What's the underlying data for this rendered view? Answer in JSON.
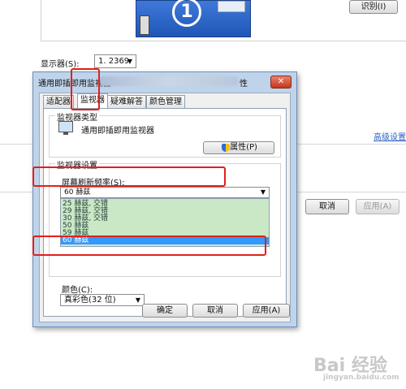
{
  "background": {
    "identify_button": "识别(I)",
    "display_label": "显示器(S):",
    "display_value": "1. 2369",
    "monitor_number": "1",
    "advanced_link": "高级设置",
    "cancel_button": "取消",
    "apply_button": "应用(A)"
  },
  "dialog": {
    "title": "通用即插即用监视器",
    "title_suffix": "性",
    "close_label": "✕",
    "tabs": [
      "适配器",
      "监视器",
      "疑难解答",
      "颜色管理"
    ],
    "monitor_type": {
      "group_title": "监视器类型",
      "name": "通用即插即用监视器",
      "properties_button": "属性(P)"
    },
    "monitor_settings": {
      "group_title": "监视器设置",
      "refresh_label": "屏幕刷新频率(S):",
      "refresh_value": "60 赫兹",
      "options": [
        "25 赫兹, 交错",
        "29 赫兹, 交错",
        "30 赫兹, 交错",
        "50 赫兹",
        "59 赫兹",
        "60 赫兹"
      ],
      "selected_index": 5
    },
    "colors": {
      "label": "颜色(C):",
      "value": "真彩色(32 位)"
    },
    "buttons": {
      "ok": "确定",
      "cancel": "取消",
      "apply": "应用(A)"
    }
  },
  "watermark": {
    "text": "Bai 经验",
    "sub": "jingyan.baidu.com"
  },
  "colors": {
    "highlight_red": "#e0201b",
    "selection_blue": "#3399ff",
    "list_green": "#cbe8c6"
  }
}
